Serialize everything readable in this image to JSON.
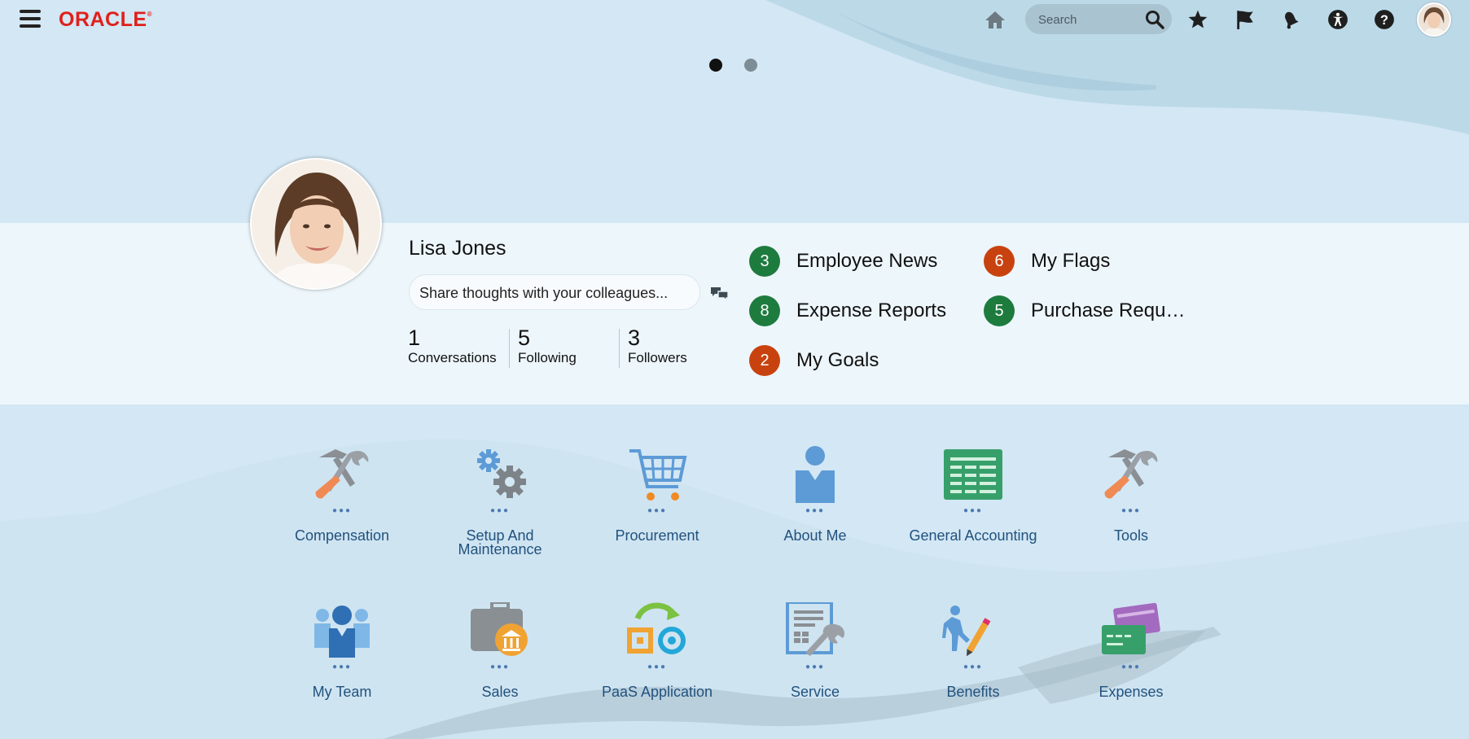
{
  "brand": {
    "logo_text": "ORACLE",
    "accent": "#e0201b"
  },
  "topbar": {
    "menu_icon": "hamburger-icon",
    "home_icon": "home-icon",
    "search": {
      "placeholder": "Search",
      "value": ""
    },
    "icons": [
      "star-icon",
      "flag-icon",
      "bell-icon",
      "accessibility-icon",
      "help-icon"
    ]
  },
  "carousel": {
    "pages": 2,
    "active": 1
  },
  "profile": {
    "name": "Lisa Jones",
    "share_placeholder": "Share thoughts with your colleagues...",
    "stats": [
      {
        "num": "1",
        "label": "Conversations"
      },
      {
        "num": "5",
        "label": "Following"
      },
      {
        "num": "3",
        "label": "Followers"
      }
    ]
  },
  "notifications": [
    {
      "count": "3",
      "label": "Employee News",
      "color": "#1e7b3e"
    },
    {
      "count": "6",
      "label": "My Flags",
      "color": "#c8420f"
    },
    {
      "count": "8",
      "label": "Expense Reports",
      "color": "#1e7b3e"
    },
    {
      "count": "5",
      "label": "Purchase Requi…",
      "color": "#1e7b3e"
    },
    {
      "count": "2",
      "label": "My Goals",
      "color": "#c8420f"
    }
  ],
  "apps_row1": [
    {
      "label": "Compensation",
      "icon": "tools-icon"
    },
    {
      "label": "Setup And Maintenance",
      "icon": "gears-icon"
    },
    {
      "label": "Procurement",
      "icon": "cart-icon"
    },
    {
      "label": "About Me",
      "icon": "person-icon"
    },
    {
      "label": "General Accounting",
      "icon": "ledger-icon"
    },
    {
      "label": "Tools",
      "icon": "tools-icon"
    }
  ],
  "apps_row2": [
    {
      "label": "My Team",
      "icon": "team-icon"
    },
    {
      "label": "Sales",
      "icon": "briefcase-icon"
    },
    {
      "label": "PaaS Application",
      "icon": "paas-icon"
    },
    {
      "label": "Service",
      "icon": "service-icon"
    },
    {
      "label": "Benefits",
      "icon": "benefits-icon"
    },
    {
      "label": "Expenses",
      "icon": "expenses-icon"
    }
  ]
}
